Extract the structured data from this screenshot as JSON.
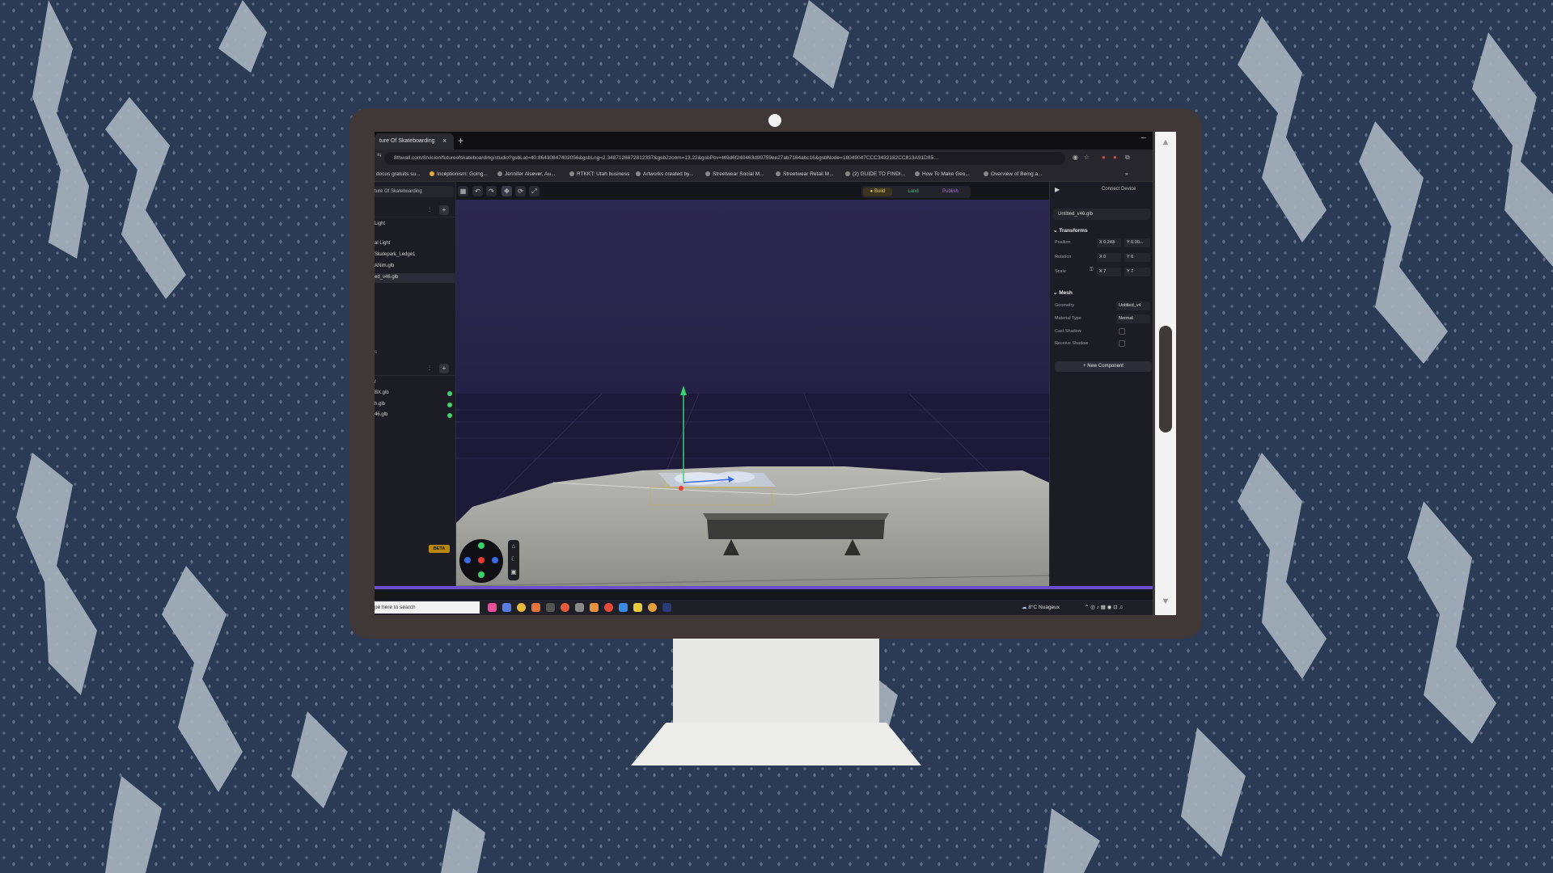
{
  "browser": {
    "tab_title": "ture Of Skateboarding",
    "tab_close": "×",
    "tab_new": "+",
    "window_min": "–",
    "url": "8thwall.com/8/vicion/futureofskateboarding/studio?gsbLat=40.86430847402056&gsbLng=2.3487126672812337&gsb2zoom=13.22&gsbPov=t49d6f240463d99759ee27ab7164abc16&gsbNode=18049047CCC3432182CC813A91D85…",
    "bookmarks": [
      "docus gratuits su...",
      "Inceptionism: Going...",
      "Jennifer Alsever, Au...",
      "RTKKT: Utah business",
      "Artworks created by...",
      "Streetwear Social M...",
      "Streetwear Retail M...",
      "(2) GUIDE TO FINDI...",
      "How To Make Geo...",
      "Overview of Being a..."
    ],
    "bookmarks_more": "»"
  },
  "app": {
    "project_name": "ture Of Skateboarding",
    "modes": {
      "build": "Build",
      "land": "Land",
      "publish": "Publish"
    },
    "connect_device": "Connect Device",
    "scene_tree": [
      "Light",
      "",
      "al Light",
      "Skatepark_Ledge1",
      "ANim.glb",
      "ed_v46.glb"
    ],
    "section2_label": "s",
    "section2_sub": "/",
    "assets": [
      "BX.glb",
      "h.glb",
      "46.glb"
    ],
    "beta_label": "BETA",
    "inspector": {
      "file_name": "Untitled_v46.glb",
      "transforms_title": "Transforms",
      "position_label": "Position",
      "position_x": "X 0.243",
      "position_y": "Y 0.00...",
      "rotation_label": "Rotation",
      "rotation_x": "X 0",
      "rotation_y": "Y 0",
      "scale_label": "Scale",
      "scale_x": "X 7",
      "scale_y": "Y 7",
      "mesh_title": "Mesh",
      "geometry_label": "Geometry",
      "geometry_value": "Untitled_v4",
      "material_label": "Material Type",
      "material_value": "Normal",
      "cast_shadow_label": "Cast Shadow",
      "receive_shadow_label": "Receive Shadow",
      "new_component": "+ New Component"
    }
  },
  "taskbar": {
    "search_placeholder": "pe here to search",
    "weather": "8°C  Nuageux",
    "clock": "S\n1/"
  },
  "colors": {
    "wallpaper": "#2b3a55",
    "wallpaper_pattern": "#a9b6c0",
    "monitor_bezel": "#3f3837",
    "stand": "#e8e8e4",
    "build_accent": "#f2c94c",
    "land_accent": "#3fbf7f",
    "publish_accent": "#a974e0",
    "status_green": "#3fd56b"
  },
  "icons": [
    "search-icon",
    "star-icon",
    "extensions-icon",
    "undo-icon",
    "redo-icon",
    "move-icon",
    "rotate-icon",
    "scale-icon",
    "filter-icon",
    "plus-icon",
    "play-icon",
    "home-icon",
    "moon-icon",
    "camera-icon",
    "chevron-down-icon",
    "lock-icon"
  ]
}
